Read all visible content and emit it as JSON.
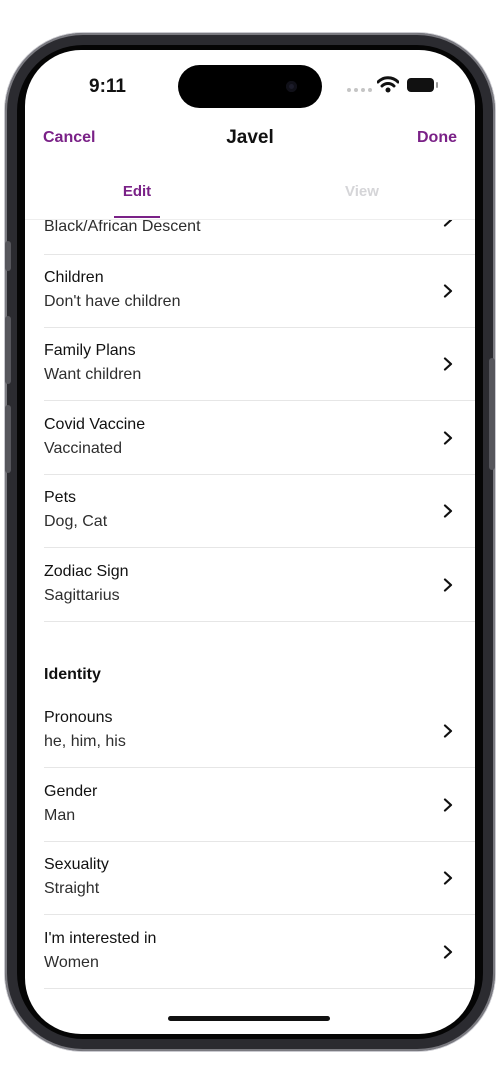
{
  "status_bar": {
    "time": "9:11"
  },
  "nav": {
    "cancel": "Cancel",
    "title": "Javel",
    "done": "Done"
  },
  "tabs": {
    "edit": "Edit",
    "view": "View"
  },
  "partial_row": {
    "value": "Black/African Descent"
  },
  "rows": [
    {
      "title": "Children",
      "value": "Don't have children"
    },
    {
      "title": "Family Plans",
      "value": "Want children"
    },
    {
      "title": "Covid Vaccine",
      "value": "Vaccinated"
    },
    {
      "title": "Pets",
      "value": "Dog, Cat"
    },
    {
      "title": "Zodiac Sign",
      "value": "Sagittarius"
    }
  ],
  "identity": {
    "heading": "Identity",
    "rows": [
      {
        "title": "Pronouns",
        "value": "he, him, his"
      },
      {
        "title": "Gender",
        "value": "Man"
      },
      {
        "title": "Sexuality",
        "value": "Straight"
      },
      {
        "title": "I'm interested in",
        "value": "Women"
      }
    ]
  },
  "icons": {
    "row_arrow": "chevron-right-icon",
    "wifi": "wifi-icon",
    "battery": "battery-icon"
  },
  "colors": {
    "accent": "#7a2187"
  }
}
